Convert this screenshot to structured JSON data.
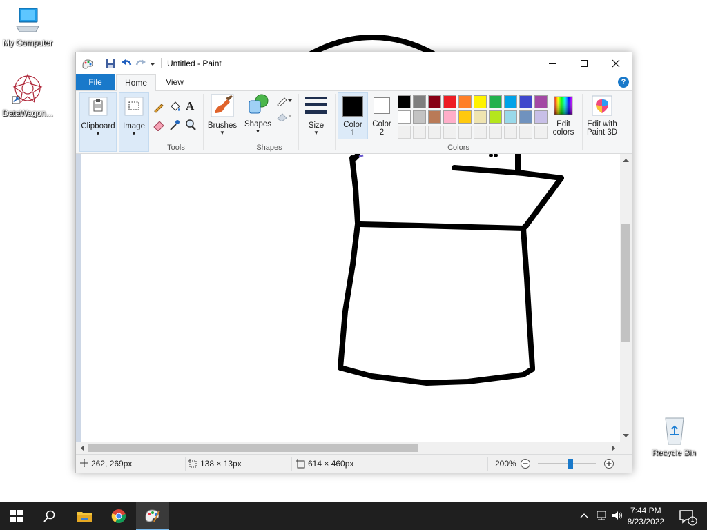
{
  "desktop": {
    "icons": [
      {
        "label": "My Computer",
        "icon": "computer-icon"
      },
      {
        "label": "DataWagon...",
        "icon": "datawagon-shortcut-icon"
      },
      {
        "label": "Recycle Bin",
        "icon": "recycle-bin-icon"
      }
    ]
  },
  "window": {
    "title": "Untitled - Paint",
    "tabs": {
      "file": "File",
      "home": "Home",
      "view": "View"
    },
    "help": "?",
    "ribbon": {
      "clipboard": "Clipboard",
      "image": "Image",
      "tools_group": "Tools",
      "brushes": "Brushes",
      "shapes": "Shapes",
      "shapes_group": "Shapes",
      "size": "Size",
      "color1": {
        "line1": "Color",
        "line2": "1"
      },
      "color2": {
        "line1": "Color",
        "line2": "2"
      },
      "colors_group": "Colors",
      "edit_colors": {
        "line1": "Edit",
        "line2": "colors"
      },
      "edit_paint3d": {
        "line1": "Edit with",
        "line2": "Paint 3D"
      },
      "palette_row1": [
        "#000000",
        "#7f7f7f",
        "#880015",
        "#ed1c24",
        "#ff7f27",
        "#fff200",
        "#22b14c",
        "#00a2e8",
        "#3f48cc",
        "#a349a4"
      ],
      "palette_row2": [
        "#ffffff",
        "#c3c3c3",
        "#b97a57",
        "#ffaec9",
        "#ffc90e",
        "#efe4b0",
        "#b5e61d",
        "#99d9ea",
        "#7092be",
        "#c8bfe7"
      ],
      "palette_row3": [
        "#f0f0f0",
        "#f0f0f0",
        "#f0f0f0",
        "#f0f0f0",
        "#f0f0f0",
        "#f0f0f0",
        "#f0f0f0",
        "#f0f0f0",
        "#f0f0f0",
        "#f0f0f0"
      ],
      "color1_value": "#000000",
      "color2_value": "#ffffff"
    },
    "status": {
      "cursor_pos": "262, 269px",
      "selection_size": "138 × 13px",
      "image_size": "614 × 460px",
      "zoom": "200%"
    }
  },
  "taskbar": {
    "time": "7:44 PM",
    "date": "8/23/2022",
    "notification_count": "1"
  }
}
